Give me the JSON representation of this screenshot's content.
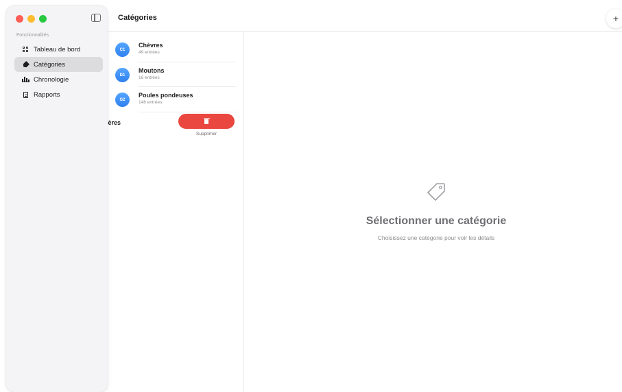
{
  "window": {
    "title": "Catégories",
    "add_label": "+"
  },
  "sidebar": {
    "section_label": "Fonctionnalités",
    "items": [
      {
        "label": "Tableau de bord",
        "icon": "dashboard-grid-icon",
        "selected": false
      },
      {
        "label": "Catégories",
        "icon": "tag-icon",
        "selected": true
      },
      {
        "label": "Chronologie",
        "icon": "chart-bars-icon",
        "selected": false
      },
      {
        "label": "Rapports",
        "icon": "document-icon",
        "selected": false
      }
    ]
  },
  "list": {
    "rows": [
      {
        "badge": "C1",
        "title": "Chèvres",
        "subtitle": "49 entrées"
      },
      {
        "badge": "D1",
        "title": "Moutons",
        "subtitle": "16 entrées"
      },
      {
        "badge": "G2",
        "title": "Poules pondeuses",
        "subtitle": "148 entrées"
      }
    ],
    "swiped_row": {
      "visible_text": "ières"
    },
    "delete_action": {
      "label": "Supprimer",
      "color": "#e9473f"
    }
  },
  "detail": {
    "empty_title": "Sélectionner une catégorie",
    "empty_subtitle": "Choisissez une catégorie pour voir les détails",
    "empty_icon": "tag-outline-icon"
  },
  "colors": {
    "accent": "#2f7fef",
    "destructive": "#e9473f"
  }
}
